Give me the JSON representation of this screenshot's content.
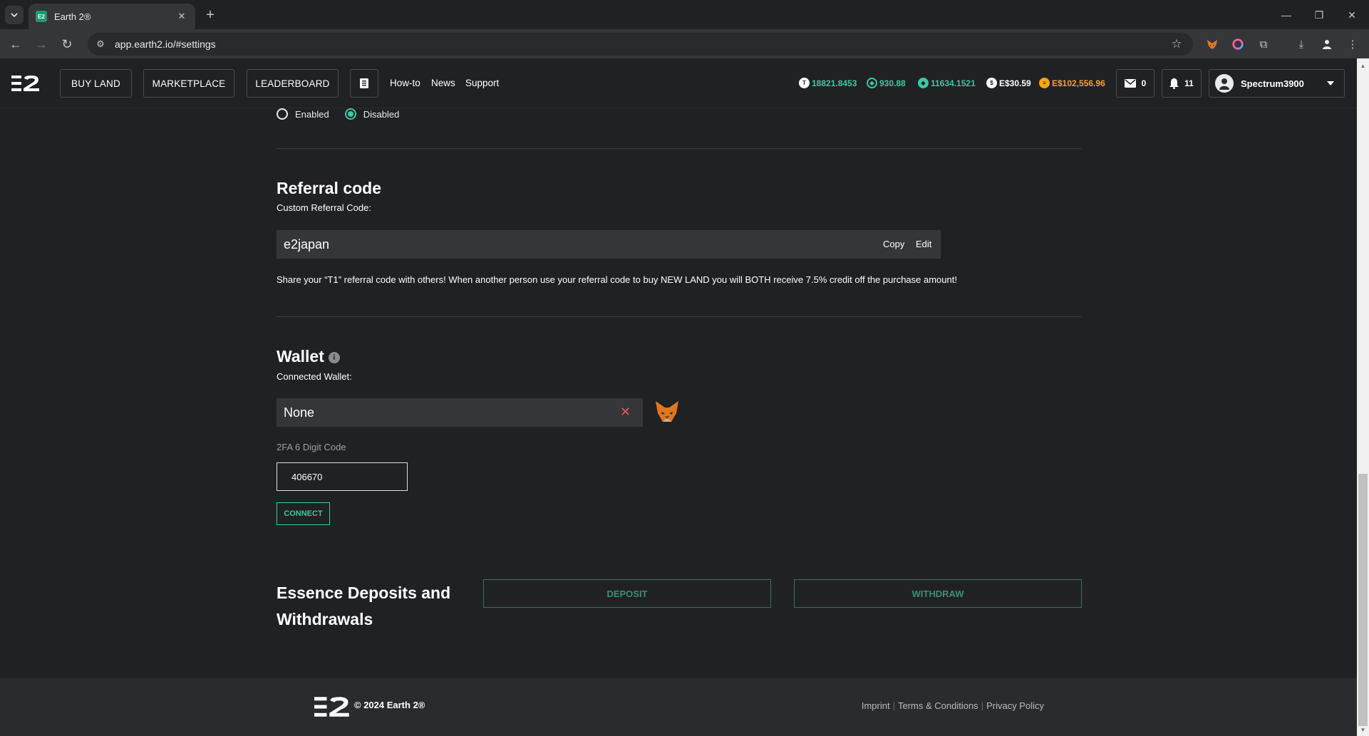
{
  "browser": {
    "tab_title": "Earth 2®",
    "url": "app.earth2.io/#settings",
    "tab_favicon_text": "E2"
  },
  "header": {
    "nav": {
      "buy_land": "BUY LAND",
      "marketplace": "MARKETPLACE",
      "leaderboard": "LEADERBOARD",
      "how_to": "How-to",
      "news": "News",
      "support": "Support"
    },
    "stats": {
      "tiles": "18821.8453",
      "gems": "930.88",
      "essence": "11634.1521",
      "cash": "E$30.59",
      "balance": "E$102,556.96"
    },
    "mail_count": "0",
    "notification_count": "11",
    "username": "Spectrum3900"
  },
  "settings": {
    "radio_enabled": "Enabled",
    "radio_disabled": "Disabled",
    "referral": {
      "title": "Referral code",
      "label": "Custom Referral Code:",
      "value": "e2japan",
      "copy": "Copy",
      "edit": "Edit",
      "description": "Share your “T1” referral code with others! When another person use your referral code to buy NEW LAND you will BOTH receive 7.5% credit off the purchase amount!"
    },
    "wallet": {
      "title": "Wallet",
      "label": "Connected Wallet:",
      "value": "None",
      "code_label": "2FA 6 Digit Code",
      "code_value": "406670",
      "connect": "CONNECT"
    },
    "essence": {
      "title_line1": "Essence Deposits and",
      "title_line2": "Withdrawals",
      "deposit": "DEPOSIT",
      "withdraw": "WITHDRAW"
    }
  },
  "footer": {
    "copyright": "© 2024 Earth 2®",
    "imprint": "Imprint",
    "terms": "Terms & Conditions",
    "privacy": "Privacy Policy"
  },
  "colors": {
    "accent": "#3ac9a2",
    "background": "#202124",
    "field": "#35363a",
    "balance_orange": "#f2a51c"
  }
}
